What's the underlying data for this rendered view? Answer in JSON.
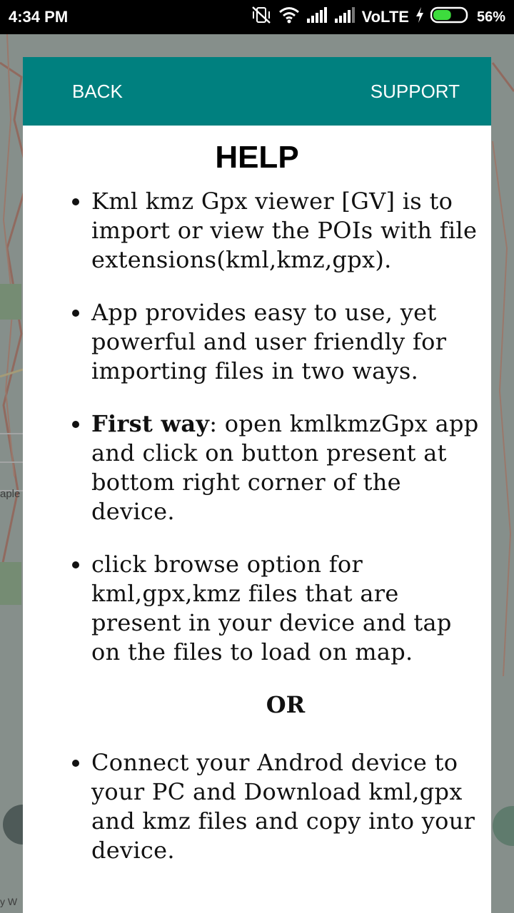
{
  "status_bar": {
    "time": "4:34 PM",
    "network": "VoLTE",
    "battery_percent": "56%",
    "battery_level": 0.56
  },
  "map": {
    "left_label": "aple",
    "attribution": "y W"
  },
  "dialog": {
    "back_label": "BACK",
    "support_label": "SUPPORT",
    "title": "HELP",
    "items": [
      {
        "bold": "",
        "text": "Kml kmz Gpx viewer [GV] is to import or view the POIs with file extensions(kml,kmz,gpx)."
      },
      {
        "bold": "",
        "text": "App provides easy to use, yet powerful and user friendly for importing files in two ways."
      },
      {
        "bold": "First way",
        "text": ": open kmlkmzGpx app and click on button present at bottom right corner of the device."
      },
      {
        "bold": "",
        "text": "click browse option for kml,gpx,kmz files that are present in your device and tap on the files to load on map."
      }
    ],
    "or_label": "OR",
    "items_after": [
      {
        "text": "Connect your Androd device to your PC and Download kml,gpx and kmz files and copy into your device."
      }
    ]
  },
  "colors": {
    "header": "#00807f",
    "status_bar": "#000000",
    "dialog_bg": "#ffffff"
  }
}
